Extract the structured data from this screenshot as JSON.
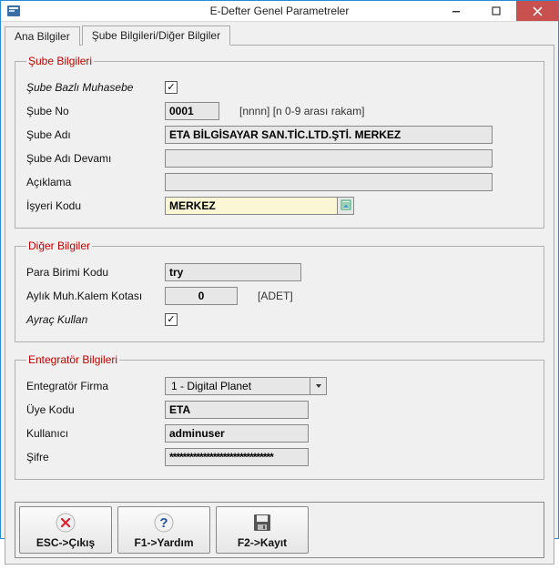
{
  "window": {
    "title": "E-Defter Genel Parametreler"
  },
  "tabs": {
    "ana": "Ana Bilgiler",
    "sube": "Şube Bilgileri/Diğer Bilgiler"
  },
  "sube_bilgileri": {
    "legend": "Şube Bilgileri",
    "sube_bazli_label": "Şube Bazlı Muhasebe",
    "sube_bazli_checked": "✓",
    "sube_no_label": "Şube No",
    "sube_no_value": "0001",
    "sube_no_hint": "[nnnn] [n 0-9 arası rakam]",
    "sube_adi_label": "Şube Adı",
    "sube_adi_value": "ETA BİLGİSAYAR SAN.TİC.LTD.ŞTİ. MERKEZ",
    "sube_adi_devami_label": "Şube Adı Devamı",
    "sube_adi_devami_value": "",
    "aciklama_label": "Açıklama",
    "aciklama_value": "",
    "isyeri_kodu_label": "İşyeri Kodu",
    "isyeri_kodu_value": "MERKEZ"
  },
  "diger_bilgiler": {
    "legend": "Diğer Bilgiler",
    "para_birimi_label": "Para Birimi Kodu",
    "para_birimi_value": "try",
    "aylik_kota_label": "Aylık Muh.Kalem Kotası",
    "aylik_kota_value": "0",
    "aylik_kota_hint": "[ADET]",
    "ayrac_kullan_label": "Ayraç Kullan",
    "ayrac_kullan_checked": "✓"
  },
  "entegrator": {
    "legend": "Entegratör Bilgileri",
    "firma_label": "Entegratör Firma",
    "firma_value": "1 - Digital Planet",
    "uye_kodu_label": "Üye Kodu",
    "uye_kodu_value": "ETA",
    "kullanici_label": "Kullanıcı",
    "kullanici_value": "adminuser",
    "sifre_label": "Şifre",
    "sifre_value": "*******************************"
  },
  "footer": {
    "esc": "ESC->Çıkış",
    "f1": "F1->Yardım",
    "f2": "F2->Kayıt"
  }
}
